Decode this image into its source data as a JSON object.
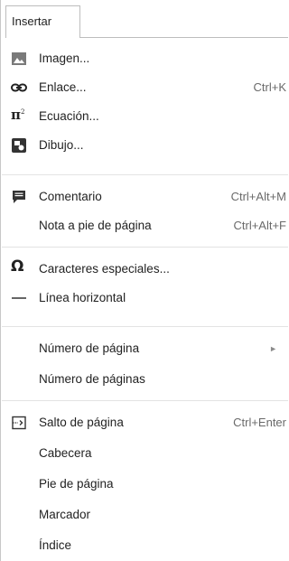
{
  "menu": {
    "tab_label": "Insertar",
    "items": [
      {
        "label": "Imagen...",
        "shortcut": "",
        "icon": "image-icon"
      },
      {
        "label": "Enlace...",
        "shortcut": "Ctrl+K",
        "icon": "link-icon"
      },
      {
        "label": "Ecuación...",
        "shortcut": "",
        "icon": "equation-icon"
      },
      {
        "label": "Dibujo...",
        "shortcut": "",
        "icon": "drawing-icon"
      },
      {
        "label": "Comentario",
        "shortcut": "Ctrl+Alt+M",
        "icon": "comment-icon"
      },
      {
        "label": "Nota a pie de página",
        "shortcut": "Ctrl+Alt+F",
        "icon": ""
      },
      {
        "label": "Caracteres especiales...",
        "shortcut": "",
        "icon": "omega-icon"
      },
      {
        "label": "Línea horizontal",
        "shortcut": "",
        "icon": "horizontal-line-icon"
      },
      {
        "label": "Número de página",
        "shortcut": "",
        "icon": "",
        "submenu": "►"
      },
      {
        "label": "Número de páginas",
        "shortcut": "",
        "icon": ""
      },
      {
        "label": "Salto de página",
        "shortcut": "Ctrl+Enter",
        "icon": "page-break-icon"
      },
      {
        "label": "Cabecera",
        "shortcut": "",
        "icon": ""
      },
      {
        "label": "Pie de página",
        "shortcut": "",
        "icon": ""
      },
      {
        "label": "Marcador",
        "shortcut": "",
        "icon": ""
      },
      {
        "label": "Índice",
        "shortcut": "",
        "icon": ""
      }
    ]
  },
  "colors": {
    "icon_gray": "#757575",
    "icon_dark": "#333333",
    "separator": "#e3e3e3",
    "shortcut_text": "#6a6a6a"
  }
}
